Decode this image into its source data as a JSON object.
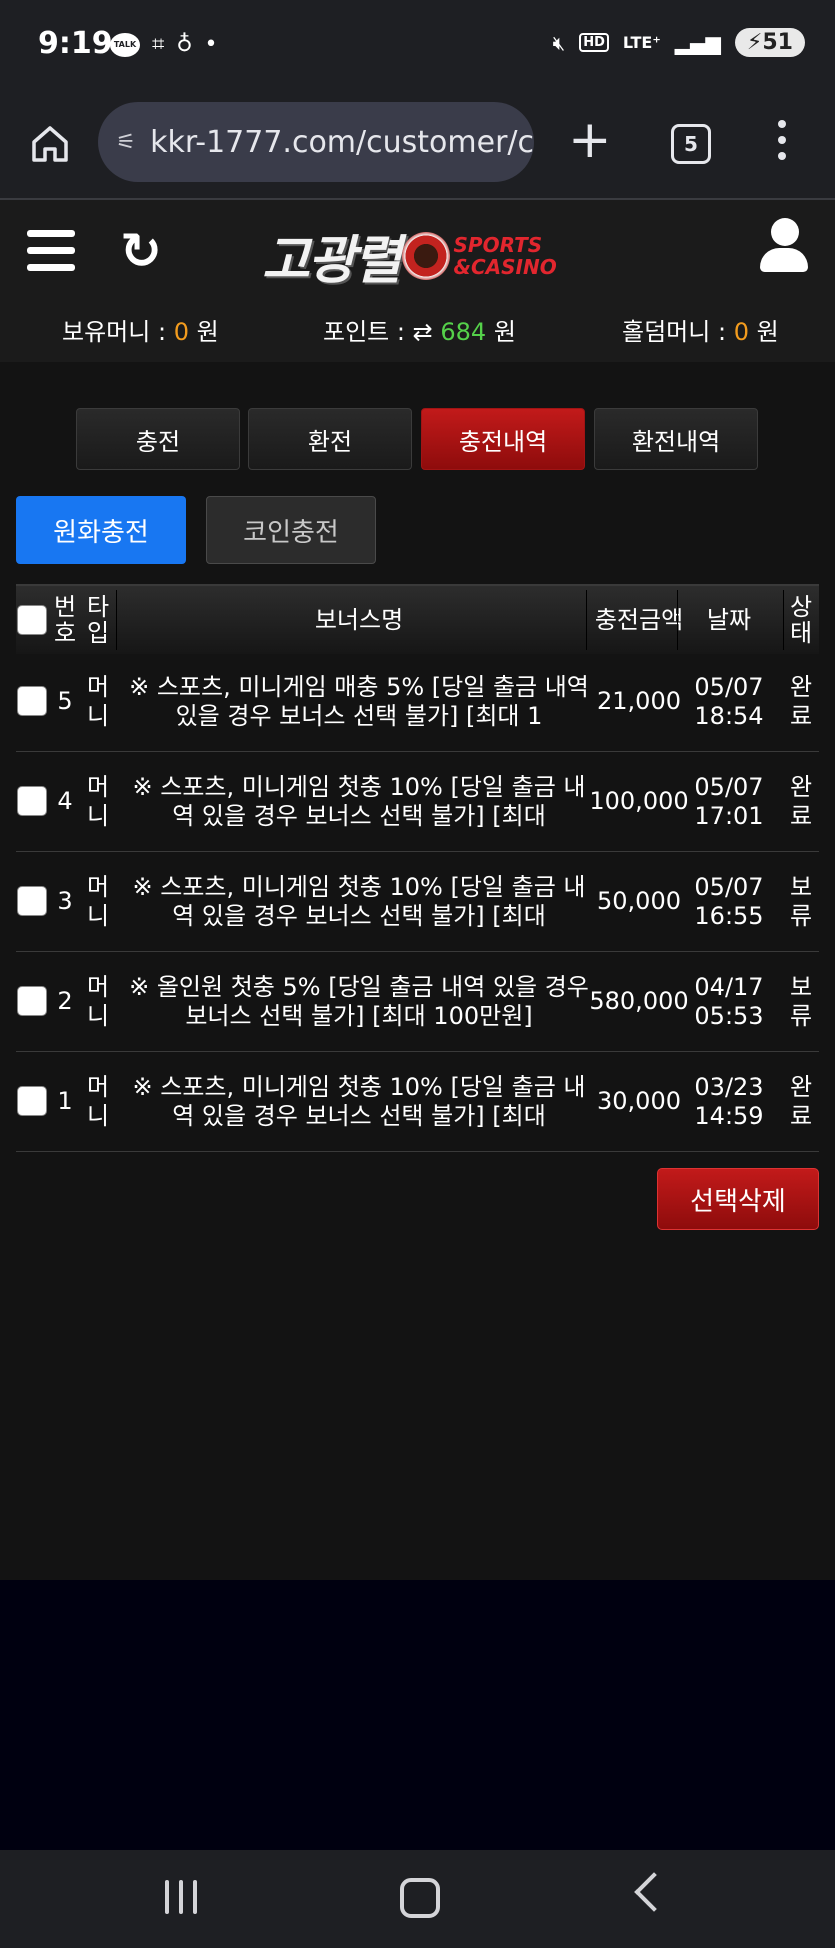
{
  "status_bar": {
    "time": "9:19",
    "talk_label": "TALK",
    "lte_label": "LTE⁺",
    "battery_level": "51"
  },
  "browser": {
    "url": "kkr-1777.com/customer/c",
    "tab_count": "5"
  },
  "header": {
    "logo_text": "고광렬",
    "logo_sub_1": "SPORTS",
    "logo_sub_2": "&CASINO",
    "money": {
      "label": "보유머니 :",
      "value": "0",
      "unit": "원"
    },
    "point": {
      "label": "포인트 :",
      "value": "684",
      "unit": "원"
    },
    "holdem": {
      "label": "홀덤머니 :",
      "value": "0",
      "unit": "원"
    }
  },
  "tabs": [
    "충전",
    "환전",
    "충전내역",
    "환전내역"
  ],
  "subtabs": [
    "원화충전",
    "코인충전"
  ],
  "table": {
    "headers": {
      "no": "번\n호",
      "type": "타\n입",
      "bonus": "보너스명",
      "amount": "충전금액",
      "date": "날짜",
      "status": "상\n태"
    },
    "rows": [
      {
        "no": "5",
        "type": "머\n니",
        "bonus": "※ 스포츠, 미니게임 매충 5% [당일 출금 내역 있을 경우 보너스 선택 불가] [최대 1",
        "amount": "21,000",
        "date": "05/07\n18:54",
        "status": "완\n료"
      },
      {
        "no": "4",
        "type": "머\n니",
        "bonus": "※ 스포츠, 미니게임 첫충 10% [당일 출금 내역 있을 경우 보너스 선택 불가] [최대",
        "amount": "100,000",
        "date": "05/07\n17:01",
        "status": "완\n료"
      },
      {
        "no": "3",
        "type": "머\n니",
        "bonus": "※ 스포츠, 미니게임 첫충 10% [당일 출금 내역 있을 경우 보너스 선택 불가] [최대",
        "amount": "50,000",
        "date": "05/07\n16:55",
        "status": "보\n류"
      },
      {
        "no": "2",
        "type": "머\n니",
        "bonus": "※ 올인원 첫충 5% [당일 출금 내역 있을 경우 보너스 선택 불가] [최대 100만원]",
        "amount": "580,000",
        "date": "04/17\n05:53",
        "status": "보\n류"
      },
      {
        "no": "1",
        "type": "머\n니",
        "bonus": "※ 스포츠, 미니게임 첫충 10% [당일 출금 내역 있을 경우 보너스 선택 불가] [최대",
        "amount": "30,000",
        "date": "03/23\n14:59",
        "status": "완\n료"
      }
    ]
  },
  "delete_button": "선택삭제"
}
